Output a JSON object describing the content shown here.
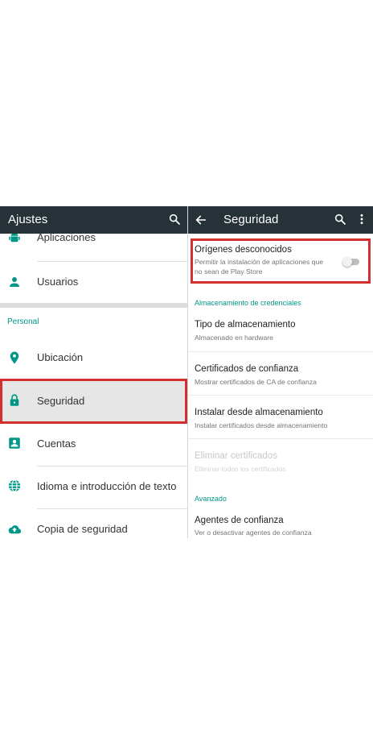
{
  "left_panel": {
    "title": "Ajustes",
    "items": [
      {
        "label": "Aplicaciones",
        "icon": "android-icon"
      },
      {
        "label": "Usuarios",
        "icon": "person-icon"
      }
    ],
    "section_personal": "Personal",
    "personal_items": [
      {
        "label": "Ubicación",
        "icon": "location-pin-icon"
      },
      {
        "label": "Seguridad",
        "icon": "lock-icon"
      },
      {
        "label": "Cuentas",
        "icon": "account-box-icon"
      },
      {
        "label": "Idioma e introducción de texto",
        "icon": "globe-icon"
      },
      {
        "label": "Copia de seguridad",
        "icon": "cloud-upload-icon"
      }
    ]
  },
  "right_panel": {
    "title": "Seguridad",
    "unknown_sources": {
      "title": "Orígenes desconocidos",
      "subtitle_line1": "Permitir la instalación de aplicaciones que",
      "subtitle_line2": "no sean de Play Store",
      "enabled": false
    },
    "section_credentials": "Almacenamiento de credenciales",
    "credential_items": [
      {
        "title": "Tipo de almacenamiento",
        "subtitle": "Almacenado en hardware",
        "enabled": true
      },
      {
        "title": "Certificados de confianza",
        "subtitle": "Mostrar certificados de CA de confianza",
        "enabled": true
      },
      {
        "title": "Instalar desde almacenamiento",
        "subtitle": "Instalar certificados desde almacenamiento",
        "enabled": true
      },
      {
        "title": "Eliminar certificados",
        "subtitle": "Eliminar todos los certificados",
        "enabled": false
      }
    ],
    "section_advanced": "Avanzado",
    "advanced_items": [
      {
        "title": "Agentes de confianza",
        "subtitle": "Ver o desactivar agentes de confianza",
        "enabled": true
      }
    ]
  },
  "colors": {
    "appbar": "#263238",
    "accent": "#009688",
    "highlight": "#d32f2f",
    "selected_row": "#e6e6e6"
  }
}
